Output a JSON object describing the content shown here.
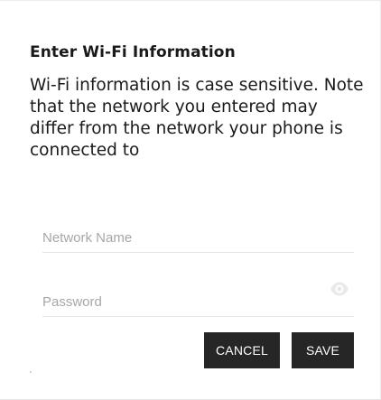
{
  "dialog": {
    "title": "Enter Wi-Fi Information",
    "description": "Wi-Fi information is case sensitive. Note that the network you entered may differ from the network your phone is connected to"
  },
  "fields": {
    "network_name": {
      "value": "",
      "placeholder": "Network Name"
    },
    "password": {
      "value": "",
      "placeholder": "Password",
      "toggle_icon": "eye-icon"
    }
  },
  "buttons": {
    "cancel_label": "CANCEL",
    "save_label": "SAVE"
  },
  "colors": {
    "button_bg": "#262626",
    "button_text": "#ffffff",
    "placeholder": "#a7a7a7",
    "divider": "#e3e3e3"
  }
}
